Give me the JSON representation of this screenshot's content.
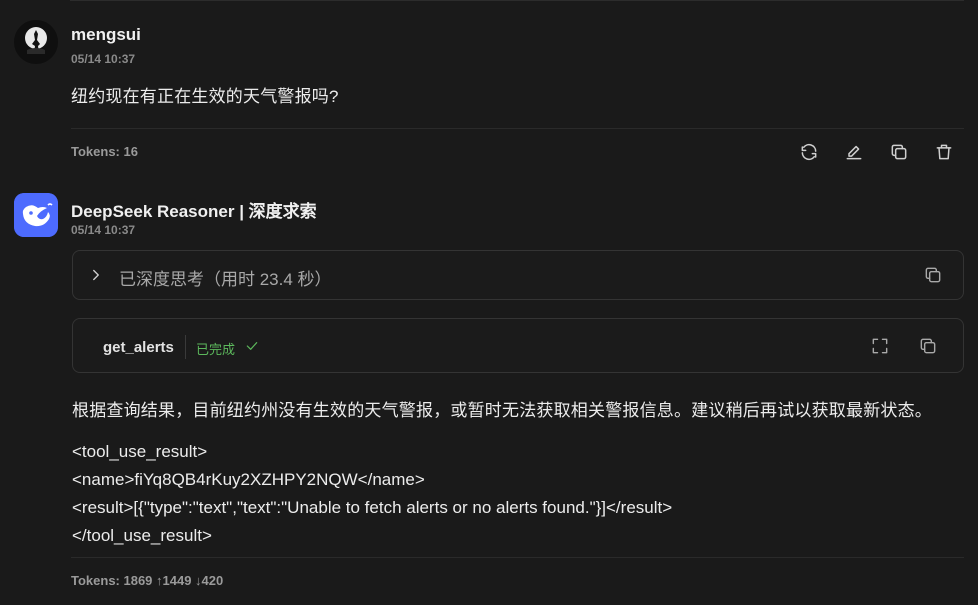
{
  "user_message": {
    "author": "mengsui",
    "timestamp": "05/14 10:37",
    "text": "纽约现在有正在生效的天气警报吗?",
    "tokens": "Tokens: 16",
    "actions": [
      "refresh-icon",
      "edit-icon",
      "copy-icon",
      "trash-icon"
    ]
  },
  "bot_message": {
    "author": "DeepSeek Reasoner | 深度求索",
    "timestamp": "05/14 10:37",
    "thinking_label": "已深度思考（用时 23.4 秒）",
    "tool": {
      "name": "get_alerts",
      "status": "已完成"
    },
    "answer": "根据查询结果，目前纽约州没有生效的天气警报，或暂时无法获取相关警报信息。建议稍后再试以获取最新状态。",
    "result_lines": [
      "<tool_use_result>",
      "<name>fiYq8QB4rKuy2XZHPY2NQW</name>",
      "<result>[{\"type\":\"text\",\"text\":\"Unable to fetch alerts or no alerts found.\"}]</result>",
      "</tool_use_result>"
    ],
    "tokens": "Tokens: 1869 ↑1449 ↓420"
  },
  "colors": {
    "background": "#1a1a1a",
    "bot_avatar": "#4d6bfe",
    "success": "#5cb85c"
  }
}
